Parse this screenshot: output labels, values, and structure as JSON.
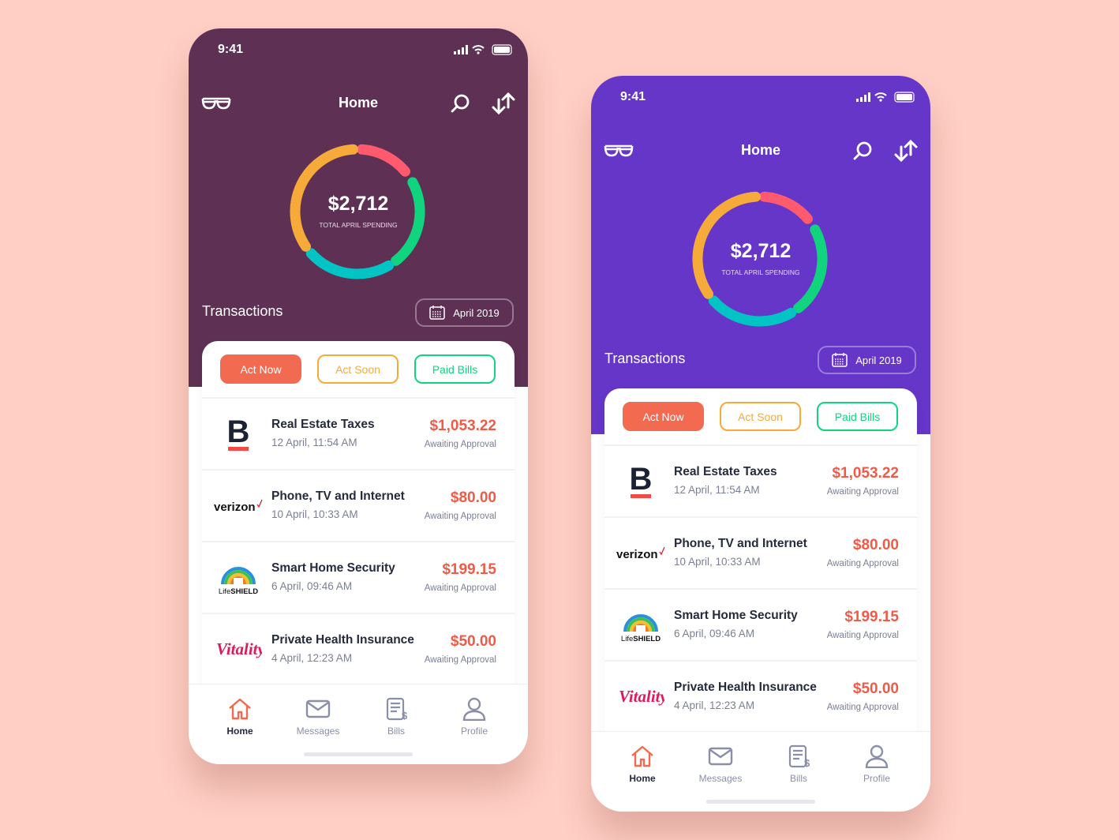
{
  "background": "#FFCEC4",
  "phones": [
    {
      "theme": "#5E3054"
    },
    {
      "theme": "#6636C8"
    }
  ],
  "app": {
    "status_time": "9:41",
    "title": "Home",
    "icons": {
      "left": "glasses-icon",
      "search": "search-icon",
      "transfer": "transfer-arrows-icon"
    },
    "total_amount": "$2,712",
    "total_label": "TOTAL APRIL SPENDING",
    "donut_segments": [
      {
        "color": "#FF5A6E",
        "start_deg": 4,
        "end_deg": 50
      },
      {
        "color": "#10D47E",
        "start_deg": 62,
        "end_deg": 142
      },
      {
        "color": "#03C4C4",
        "start_deg": 150,
        "end_deg": 228
      },
      {
        "color": "#F6AA3A",
        "start_deg": 236,
        "end_deg": 356
      }
    ],
    "transactions_label": "Transactions",
    "month_label": "April 2019",
    "tabs": [
      {
        "label": "Act Now",
        "color": "#F26A50",
        "active": true
      },
      {
        "label": "Act Soon",
        "color": "#F6AA3A",
        "active": false
      },
      {
        "label": "Paid Bills",
        "color": "#10D47E",
        "active": false
      }
    ],
    "items": [
      {
        "logo": "B",
        "name": "Real Estate Taxes",
        "date": "12 April, 11:54 AM",
        "amount": "$1,053.22",
        "status": "Awaiting Approval"
      },
      {
        "logo": "verizon",
        "name": "Phone, TV and  Internet",
        "date": "10 April, 10:33 AM",
        "amount": "$80.00",
        "status": "Awaiting Approval"
      },
      {
        "logo": "LifeSHIELD",
        "name": "Smart Home Security",
        "date": "6 April, 09:46 AM",
        "amount": "$199.15",
        "status": "Awaiting Approval"
      },
      {
        "logo": "Vitality",
        "name": "Private Health Insurance",
        "date": "4 April, 12:23 AM",
        "amount": "$50.00",
        "status": "Awaiting Approval"
      }
    ],
    "nav": [
      {
        "label": "Home",
        "icon": "home-icon",
        "active": true
      },
      {
        "label": "Messages",
        "icon": "envelope-icon",
        "active": false
      },
      {
        "label": "Bills",
        "icon": "bill-icon",
        "active": false
      },
      {
        "label": "Profile",
        "icon": "user-icon",
        "active": false
      }
    ]
  }
}
